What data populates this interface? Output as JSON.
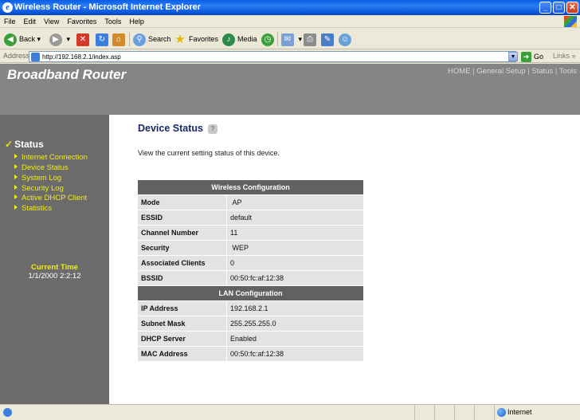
{
  "window": {
    "title": "Wireless Router - Microsoft Internet Explorer"
  },
  "menu": [
    "File",
    "Edit",
    "View",
    "Favorites",
    "Tools",
    "Help"
  ],
  "toolbar": {
    "back": "Back",
    "search": "Search",
    "favorites": "Favorites",
    "media": "Media"
  },
  "address": {
    "label": "Address",
    "url": "http://192.168.2.1/index.asp",
    "go": "Go",
    "links": "Links"
  },
  "header": {
    "brand": "Broadband Router",
    "nav": [
      "HOME",
      "General Setup",
      "Status",
      "Tools"
    ]
  },
  "sidebar": {
    "section": "Status",
    "items": [
      "Internet Connection",
      "Device Status",
      "System Log",
      "Security Log",
      "Active DHCP Client",
      "Statistics"
    ],
    "time_title": "Current Time",
    "time_value": "1/1/2000 2:2:12"
  },
  "content": {
    "title": "Device Status",
    "description": "View the current setting status of this device.",
    "wireless": {
      "heading": "Wireless Configuration",
      "rows": [
        {
          "label": "Mode",
          "value": "AP"
        },
        {
          "label": "ESSID",
          "value": "default"
        },
        {
          "label": "Channel Number",
          "value": "11"
        },
        {
          "label": "Security",
          "value": "WEP"
        },
        {
          "label": "Associated Clients",
          "value": "0"
        },
        {
          "label": "BSSID",
          "value": "00:50:fc:af:12:38"
        }
      ]
    },
    "lan": {
      "heading": "LAN Configuration",
      "rows": [
        {
          "label": "IP Address",
          "value": "192.168.2.1"
        },
        {
          "label": "Subnet Mask",
          "value": "255.255.255.0"
        },
        {
          "label": "DHCP Server",
          "value": "Enabled"
        },
        {
          "label": "MAC Address",
          "value": "00:50:fc:af:12:38"
        }
      ]
    }
  },
  "statusbar": {
    "zone": "Internet"
  }
}
